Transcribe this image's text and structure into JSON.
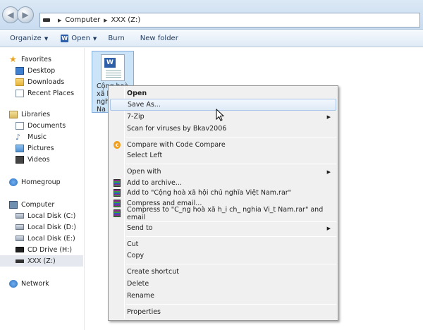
{
  "address": {
    "crumbs": [
      "Computer",
      "XXX (Z:)"
    ]
  },
  "toolbar": {
    "organize": "Organize",
    "open": "Open",
    "burn": "Burn",
    "new_folder": "New folder"
  },
  "nav": {
    "favorites": "Favorites",
    "desktop": "Desktop",
    "downloads": "Downloads",
    "recent_places": "Recent Places",
    "libraries": "Libraries",
    "documents": "Documents",
    "music": "Music",
    "pictures": "Pictures",
    "videos": "Videos",
    "homegroup": "Homegroup",
    "computer": "Computer",
    "local_c": "Local Disk (C:)",
    "local_d": "Local Disk (D:)",
    "local_e": "Local Disk (E:)",
    "cd_drive": "CD Drive (H:)",
    "xxx_z": "XXX (Z:)",
    "network": "Network"
  },
  "file": {
    "name_lines": [
      "Cộng hoà",
      "xã h",
      "ngh",
      "Na"
    ]
  },
  "context_menu": {
    "open": "Open",
    "save_as": "Save As...",
    "seven_zip": "7-Zip",
    "scan": "Scan for viruses by Bkav2006",
    "compare": "Compare with Code Compare",
    "select_left": "Select Left",
    "open_with": "Open with",
    "add_archive": "Add to archive...",
    "add_to_rar": "Add to \"Cộng hoà xã hội chủ nghĩa Việt Nam.rar\"",
    "compress_email": "Compress and email...",
    "compress_to_rar_email": "Compress to \"C_ng hoà xã h_i ch_ nghia Vi_t Nam.rar\" and email",
    "send_to": "Send to",
    "cut": "Cut",
    "copy": "Copy",
    "create_shortcut": "Create shortcut",
    "delete": "Delete",
    "rename": "Rename",
    "properties": "Properties"
  }
}
